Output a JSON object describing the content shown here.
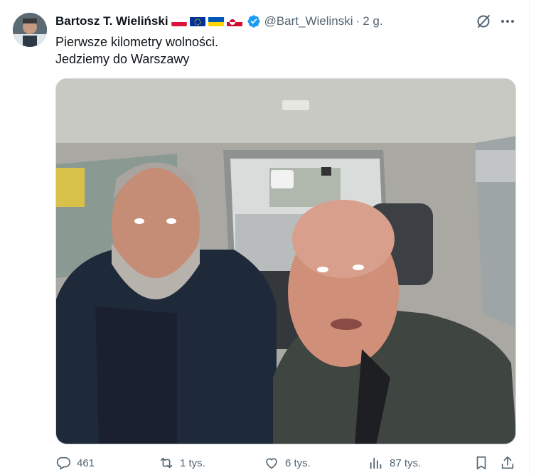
{
  "tweet": {
    "author_name": "Bartosz T. Wieliński",
    "handle": "@Bart_Wielinski",
    "separator": "·",
    "time": "2 g.",
    "text_line1": "Pierwsze kilometry wolności.",
    "text_line2": "Jedziemy do Warszawy",
    "flags": [
      "poland-flag",
      "eu-flag",
      "ukraine-flag",
      "greenland-flag"
    ]
  },
  "actions": {
    "replies": "461",
    "reposts": "1 tys.",
    "likes": "6 tys.",
    "views": "87 tys."
  },
  "colors": {
    "text": "#0f1419",
    "secondary": "#536471",
    "verified": "#1d9bf0",
    "border": "#cfd9de"
  }
}
